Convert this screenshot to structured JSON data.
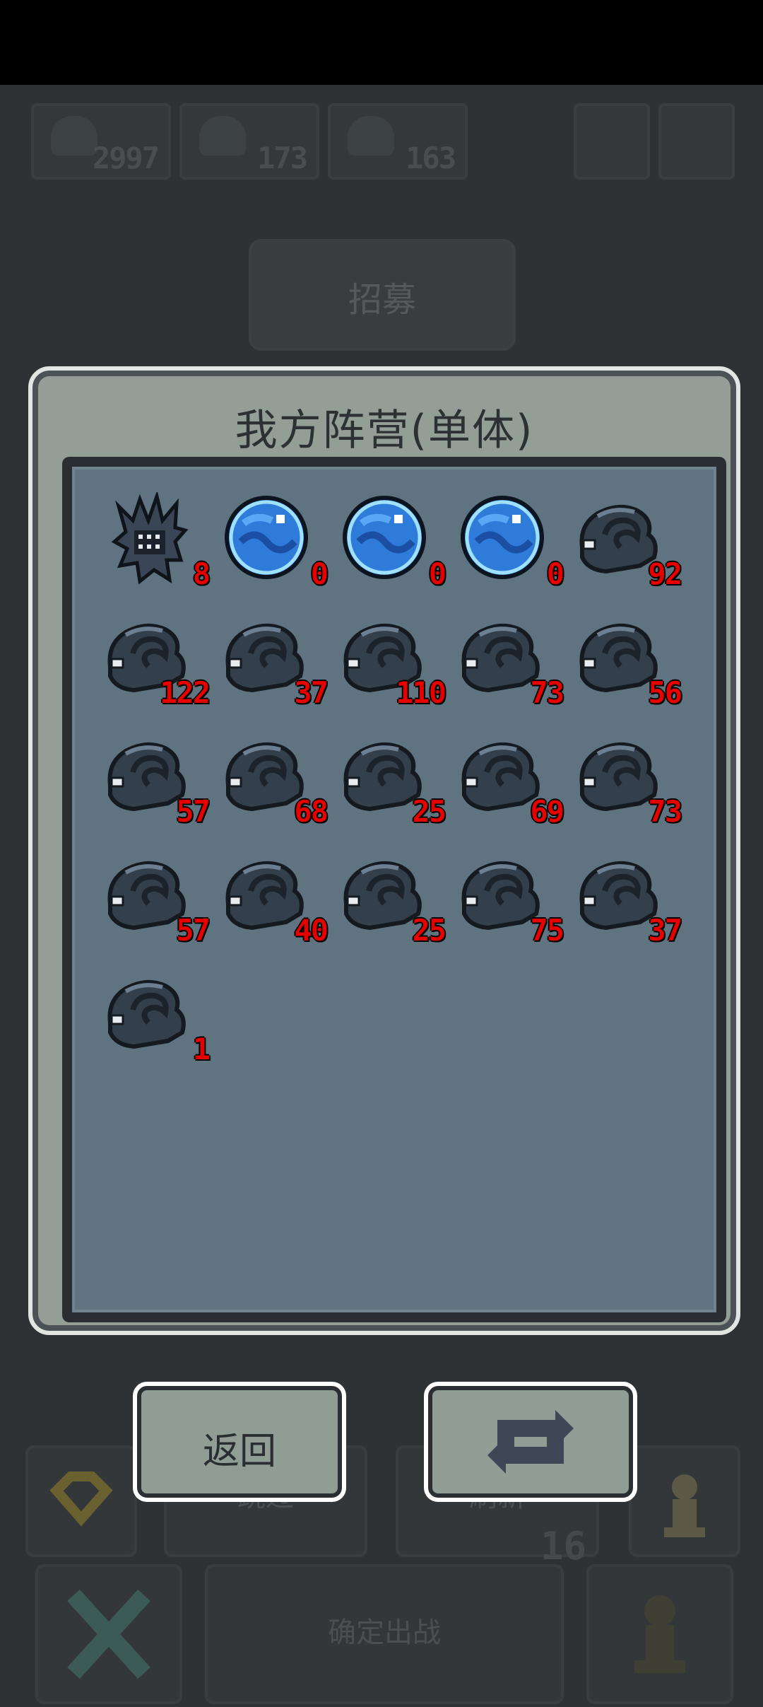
{
  "background": {
    "resources": [
      "2997",
      "173",
      "163"
    ],
    "recruit_label": "招募",
    "bottom_buttons": {
      "skip_label": "跳过",
      "refresh_label": "刷新",
      "refresh_count": "16",
      "confirm_label": "确定出战"
    }
  },
  "dialog": {
    "title": "我方阵营(单体)",
    "units": [
      {
        "icon": "spiky-robot-icon",
        "count": "8"
      },
      {
        "icon": "blue-orb-icon",
        "count": "0"
      },
      {
        "icon": "blue-orb-icon",
        "count": "0"
      },
      {
        "icon": "blue-orb-icon",
        "count": "0"
      },
      {
        "icon": "shadow-beast-icon",
        "count": "92"
      },
      {
        "icon": "shadow-beast-icon",
        "count": "122"
      },
      {
        "icon": "shadow-beast-icon",
        "count": "37"
      },
      {
        "icon": "shadow-beast-icon",
        "count": "110"
      },
      {
        "icon": "shadow-beast-icon",
        "count": "73"
      },
      {
        "icon": "shadow-beast-icon",
        "count": "56"
      },
      {
        "icon": "shadow-beast-icon",
        "count": "57"
      },
      {
        "icon": "shadow-beast-icon",
        "count": "68"
      },
      {
        "icon": "shadow-beast-icon",
        "count": "25"
      },
      {
        "icon": "shadow-beast-icon",
        "count": "69"
      },
      {
        "icon": "shadow-beast-icon",
        "count": "73"
      },
      {
        "icon": "shadow-beast-icon",
        "count": "57"
      },
      {
        "icon": "shadow-beast-icon",
        "count": "40"
      },
      {
        "icon": "shadow-beast-icon",
        "count": "25"
      },
      {
        "icon": "shadow-beast-icon",
        "count": "75"
      },
      {
        "icon": "shadow-beast-icon",
        "count": "37"
      },
      {
        "icon": "shadow-beast-icon",
        "count": "1"
      }
    ],
    "back_label": "返回",
    "refresh_icon": "refresh-icon"
  },
  "colors": {
    "count_red": "#e60000",
    "panel": "#939f96",
    "grid_bg": "#5f7480"
  }
}
